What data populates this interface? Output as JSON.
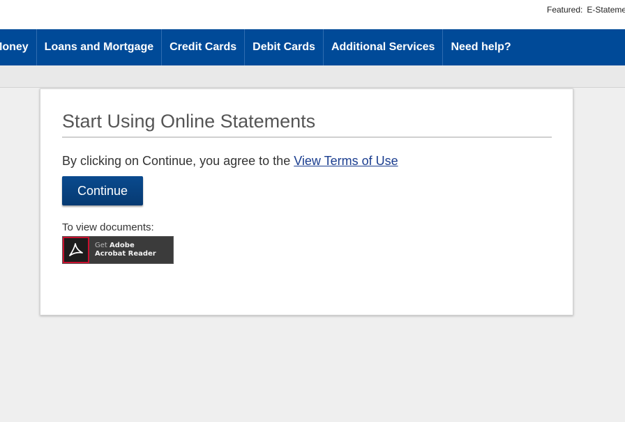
{
  "header": {
    "featured_label": "Featured:",
    "featured_value": "E-Statements"
  },
  "nav": {
    "items": [
      {
        "label": "Money"
      },
      {
        "label": "Loans and Mortgage"
      },
      {
        "label": "Credit Cards"
      },
      {
        "label": "Debit Cards"
      },
      {
        "label": "Additional Services"
      },
      {
        "label": "Need help?"
      }
    ]
  },
  "main": {
    "title": "Start Using Online Statements",
    "agree_text": "By clicking on Continue, you agree to the",
    "terms_link": "View Terms of Use",
    "continue_label": "Continue",
    "view_docs_label": "To view documents:",
    "adobe": {
      "get_text": "Get",
      "brand_line1": "Adobe",
      "brand_line2": "Acrobat Reader"
    }
  },
  "colors": {
    "nav_bg": "#004a98",
    "button_bg": "#063a72",
    "link": "#1a3d8f",
    "adobe_red": "#c8102e"
  },
  "icons": [
    "adobe-acrobat-icon"
  ]
}
